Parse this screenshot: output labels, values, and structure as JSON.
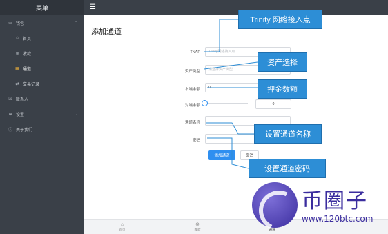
{
  "sidebar": {
    "title": "菜单",
    "items": [
      {
        "label": "钱包",
        "icon": "wallet-icon",
        "expanded": true
      },
      {
        "label": "首页",
        "icon": "home-icon"
      },
      {
        "label": "收款",
        "icon": "receive-icon"
      },
      {
        "label": "通道",
        "icon": "channel-icon",
        "active": true
      },
      {
        "label": "交易记录",
        "icon": "history-icon"
      },
      {
        "label": "联系人",
        "icon": "contacts-icon"
      },
      {
        "label": "设置",
        "icon": "settings-icon"
      },
      {
        "label": "关于我们",
        "icon": "info-icon"
      }
    ]
  },
  "topbar": {
    "menu_icon": "hamburger-icon"
  },
  "form": {
    "title": "添加通道",
    "tnap": {
      "label": "TNAP",
      "placeholder": "Trinity网络接入点"
    },
    "asset": {
      "label": "资产类型",
      "placeholder": "请选择资产类型"
    },
    "deposit": {
      "label": "本端余额",
      "value": "0"
    },
    "peer_deposit": {
      "label": "对端余额",
      "value": "0",
      "slider_fraction": 0
    },
    "name": {
      "label": "通道名称",
      "value": ""
    },
    "password": {
      "label": "密码",
      "value": ""
    },
    "submit_label": "添加通道",
    "cancel_label": "取消"
  },
  "tabbar": {
    "tabs": [
      {
        "label": "首页",
        "icon": "home-icon"
      },
      {
        "label": "收款",
        "icon": "receive-icon"
      },
      {
        "label": "通道",
        "icon": "channel-icon",
        "active": true
      }
    ]
  },
  "callouts": {
    "tnap": "Trinity 网络接入点",
    "asset": "资产选择",
    "deposit": "押金数额",
    "name": "设置通道名称",
    "password": "设置通道密码"
  },
  "watermark": {
    "text": "币圈子",
    "url": "www.120btc.com"
  },
  "colors": {
    "sidebar": "#3a4048",
    "primary": "#2f8ff0",
    "callout": "#2d8ed6",
    "active_icon": "#f0b23a"
  }
}
